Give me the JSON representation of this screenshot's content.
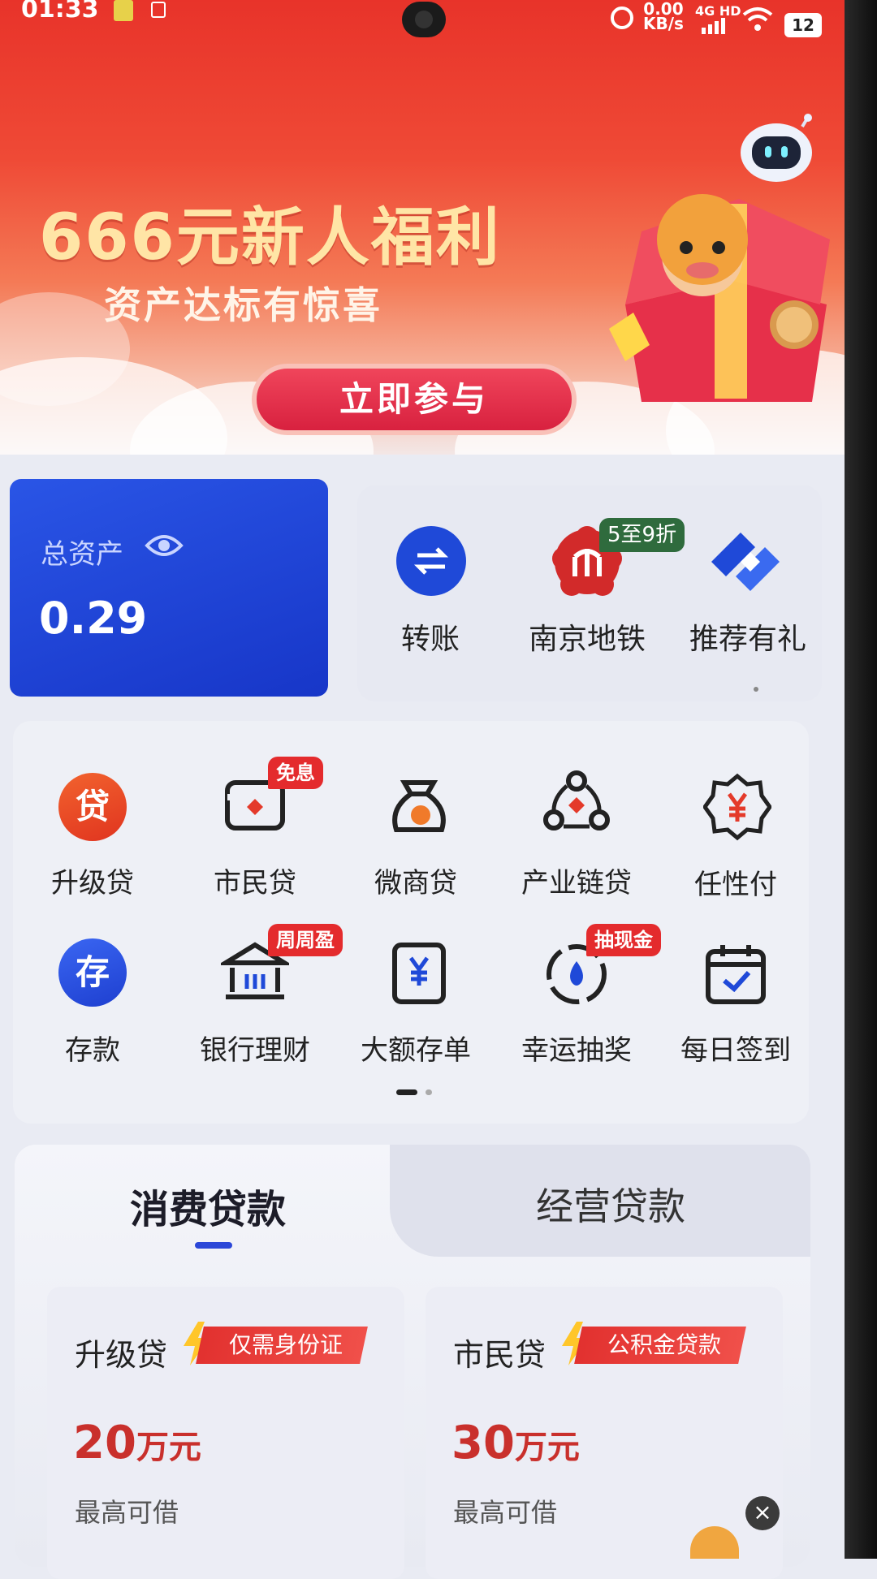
{
  "status_bar": {
    "time": "01:33",
    "net_speed": "0.00",
    "net_unit": "KB/s",
    "network": "4G HD",
    "battery": "12"
  },
  "banner": {
    "title": "666元新人福利",
    "subtitle": "资产达标有惊喜",
    "cta": "立即参与",
    "colors": {
      "primary": "#e8332a",
      "title_gold": "#ffe5a6"
    }
  },
  "assets": {
    "label": "总资产",
    "value": "0.29",
    "icon": "eye-icon"
  },
  "quick_actions": [
    {
      "label": "转账",
      "icon": "transfer-icon"
    },
    {
      "label": "南京地铁",
      "icon": "nanjing-metro-icon",
      "tag": "5至9折"
    },
    {
      "label": "推荐有礼",
      "icon": "referral-icon"
    }
  ],
  "services": {
    "row1": [
      {
        "label": "升级贷",
        "icon": "loan-badge-icon"
      },
      {
        "label": "市民贷",
        "icon": "citizen-loan-icon",
        "tag": "免息"
      },
      {
        "label": "微商贷",
        "icon": "money-bag-icon"
      },
      {
        "label": "产业链贷",
        "icon": "chain-icon"
      },
      {
        "label": "任性付",
        "icon": "yen-gear-icon"
      }
    ],
    "row2": [
      {
        "label": "存款",
        "icon": "deposit-icon"
      },
      {
        "label": "银行理财",
        "icon": "bank-icon",
        "tag": "周周盈"
      },
      {
        "label": "大额存单",
        "icon": "certificate-icon"
      },
      {
        "label": "幸运抽奖",
        "icon": "lottery-icon",
        "tag": "抽现金"
      },
      {
        "label": "每日签到",
        "icon": "calendar-check-icon"
      }
    ],
    "page_indicator": {
      "pages": 2,
      "current": 1
    }
  },
  "loans": {
    "tabs": [
      {
        "label": "消费贷款",
        "active": true
      },
      {
        "label": "经营贷款",
        "active": false
      }
    ],
    "products": [
      {
        "name": "升级贷",
        "badge": "仅需身份证",
        "amount": "20",
        "unit": "万元",
        "caption": "最高可借"
      },
      {
        "name": "市民贷",
        "badge": "公积金贷款",
        "amount": "30",
        "unit": "万元",
        "caption": "最高可借"
      }
    ]
  }
}
